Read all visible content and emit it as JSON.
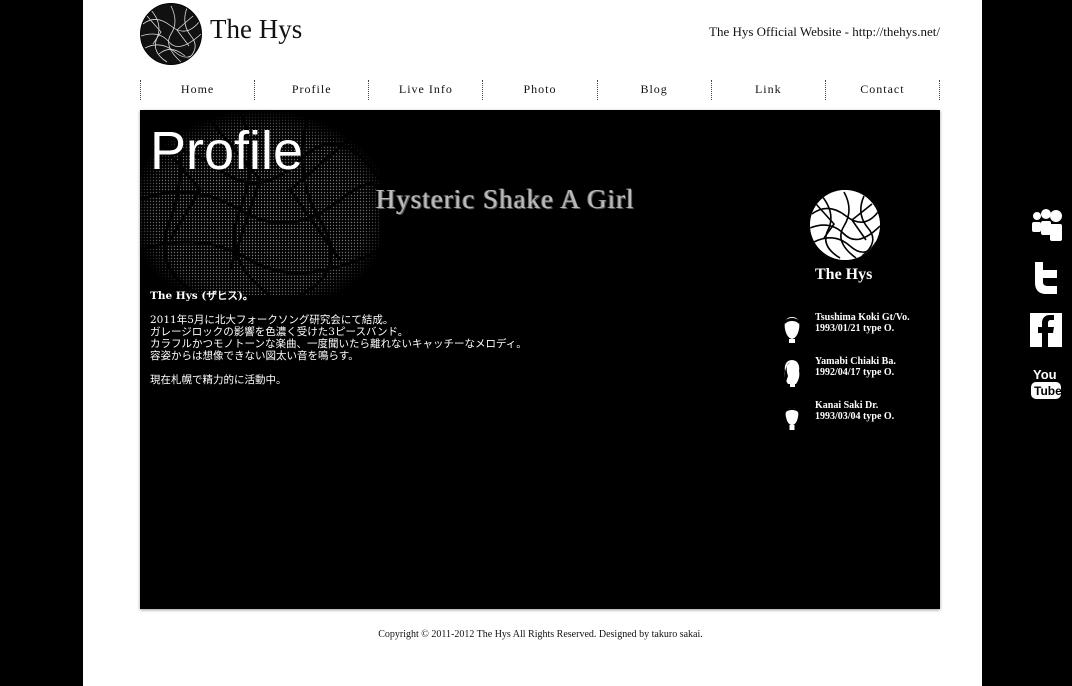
{
  "header": {
    "site_title": "The Hys",
    "tagline": "The Hys Official Website - http://thehys.net/"
  },
  "nav": {
    "items": [
      {
        "label": "Home"
      },
      {
        "label": "Profile"
      },
      {
        "label": "Live Info"
      },
      {
        "label": "Photo"
      },
      {
        "label": "Blog"
      },
      {
        "label": "Link"
      },
      {
        "label": "Contact"
      }
    ],
    "active": "Profile"
  },
  "main": {
    "heading": "Profile",
    "subtitle": "Hysteric Shake A Girl",
    "intro": {
      "name_line": "The Hys (ザヒス)。",
      "line1": "2011年5月に北大フォークソング研究会にて結成。",
      "line2": "ガレージロックの影響を色濃く受けた3ピースバンド。",
      "line3": "カラフルかつモノトーンな楽曲、一度聞いたら離れないキャッチーなメロディ。",
      "line4": "容姿からは想像できない図太い音を鳴らす。",
      "line5": "現在札幌で精力的に活動中。"
    }
  },
  "band": {
    "name": "The Hys",
    "members": [
      {
        "name_role": "Tsushima Koki Gt/Vo.",
        "birth": "1993/01/21 type O."
      },
      {
        "name_role": "Yamabi Chiaki Ba.",
        "birth": "1992/04/17 type O."
      },
      {
        "name_role": "Kanai Saki Dr.",
        "birth": "1993/03/04 type O."
      }
    ]
  },
  "footer": {
    "copyright": "Copyright © 2011-2012 The Hys All Rights Reserved. Designed by takuro sakai."
  },
  "social": {
    "youtube_line1": "You",
    "youtube_line2": "Tube"
  },
  "colors": {
    "background": "#000000",
    "page": "#ffffff",
    "panel": "#000000",
    "text_light": "#ffffff",
    "text_dark": "#111111"
  },
  "icons": [
    "myspace-icon",
    "twitter-icon",
    "facebook-icon",
    "youtube-icon"
  ]
}
